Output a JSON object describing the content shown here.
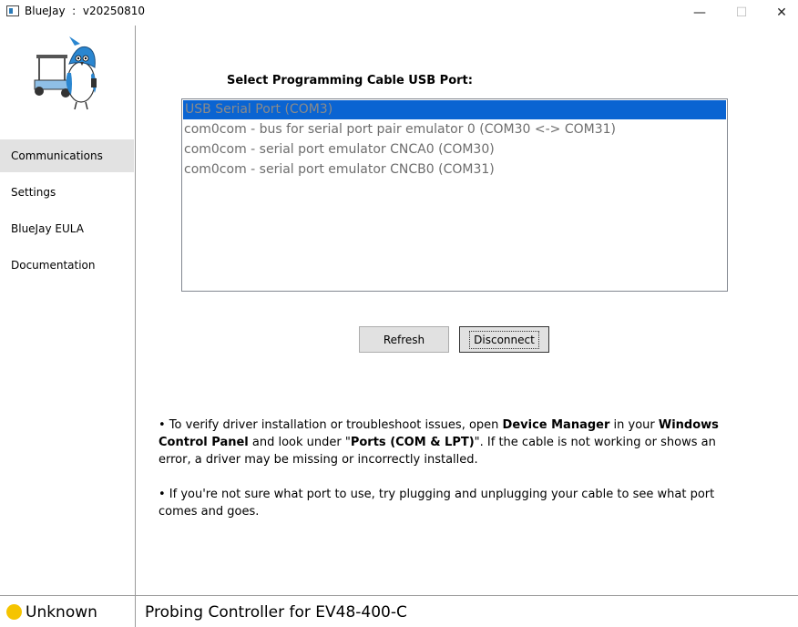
{
  "window": {
    "title": "BlueJay  :  v20250810",
    "minimize_glyph": "—",
    "maximize_glyph": "☐",
    "close_glyph": "✕"
  },
  "sidebar": {
    "logo_icon": "bluejay-mascot-logo",
    "items": [
      {
        "label": "Communications",
        "active": true
      },
      {
        "label": "Settings",
        "active": false
      },
      {
        "label": "BlueJay EULA",
        "active": false
      },
      {
        "label": "Documentation",
        "active": false
      }
    ]
  },
  "main": {
    "heading": "Select Programming Cable USB Port:",
    "ports": [
      {
        "label": "USB Serial Port (COM3)",
        "selected": true
      },
      {
        "label": "com0com - bus for serial port pair emulator 0 (COM30 <-> COM31)",
        "selected": false
      },
      {
        "label": "com0com - serial port emulator CNCA0 (COM30)",
        "selected": false
      },
      {
        "label": "com0com - serial port emulator CNCB0 (COM31)",
        "selected": false
      }
    ],
    "refresh_label": "Refresh",
    "disconnect_label": "Disconnect",
    "note1": {
      "bullet": "•",
      "t1": " To verify driver installation or troubleshoot issues, open ",
      "b1": "Device Manager",
      "t2": " in your ",
      "b2": "Windows Control Panel",
      "t3": " and look under \"",
      "b3": "Ports (COM & LPT)",
      "t4": "\". If the cable is not working or shows an error, a driver may be missing or incorrectly installed."
    },
    "note2": "• If you're not sure what port to use, try plugging and unplugging your cable to see what port comes and goes."
  },
  "status": {
    "connection": "Unknown",
    "connection_color": "#f5c400",
    "device": "Probing Controller for EV48-400-C"
  },
  "colors": {
    "selection": "#0a64d2",
    "nav_active": "#e2e2e2"
  }
}
